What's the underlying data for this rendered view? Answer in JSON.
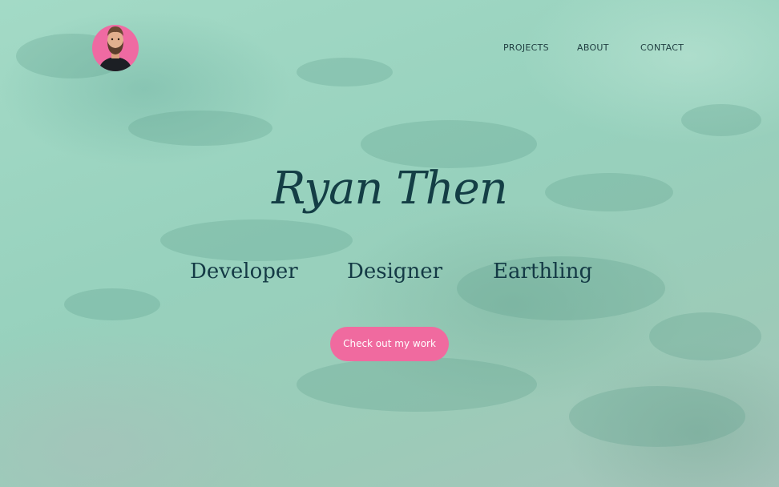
{
  "header": {
    "avatar_alt": "avatar",
    "nav": [
      {
        "label": "PROJECTS"
      },
      {
        "label": "ABOUT"
      },
      {
        "label": "CONTACT"
      }
    ]
  },
  "hero": {
    "title": "Ryan Then",
    "roles": [
      "Developer",
      "Designer",
      "Earthling"
    ],
    "cta_label": "Check out my work"
  },
  "colors": {
    "background": "#9fd4c1",
    "text_dark": "#143e45",
    "accent_pink": "#f06a9f",
    "cta_text": "#ffffff"
  }
}
